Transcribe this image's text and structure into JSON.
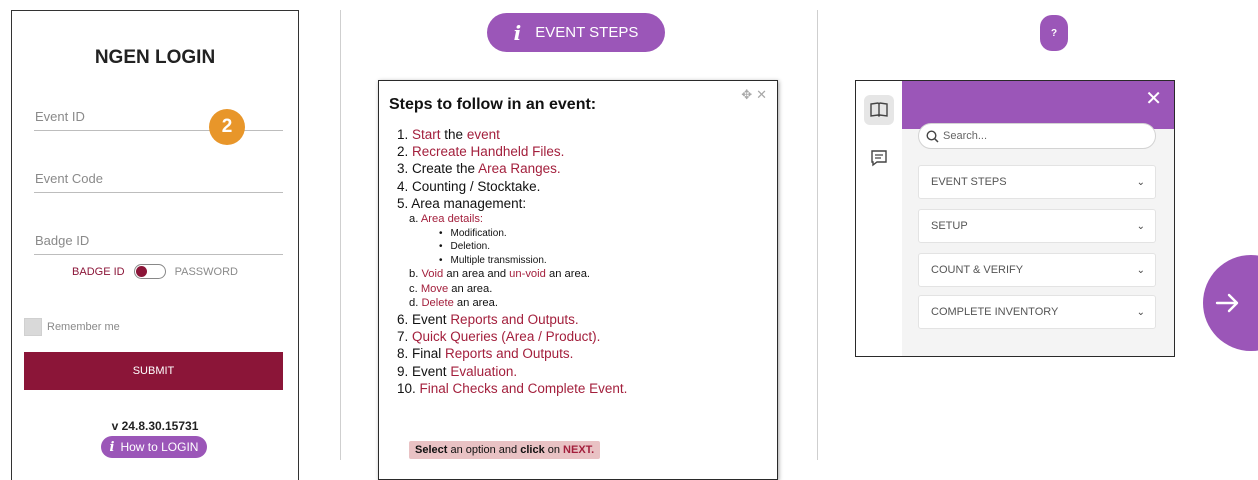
{
  "login": {
    "title": "NGEN LOGIN",
    "event_id_placeholder": "Event ID",
    "event_code_placeholder": "Event Code",
    "badge_id_placeholder": "Badge ID",
    "step_badge": "2",
    "toggle_left": "BADGE ID",
    "toggle_right": "PASSWORD",
    "remember": "Remember me",
    "submit": "SUBMIT",
    "version": "v 24.8.30.15731",
    "howto": "How to LOGIN"
  },
  "event_steps_button": {
    "label": "EVENT STEPS",
    "icon": "info-icon"
  },
  "steps_panel": {
    "title": "Steps to follow in an event:",
    "items": {
      "s1": {
        "num": "1.",
        "a": "Start",
        "b": " the ",
        "c": "event"
      },
      "s2": {
        "num": "2.",
        "a": "Recreate Handheld Files."
      },
      "s3": {
        "num": "3.",
        "a": "Create the ",
        "b": "Area Ranges."
      },
      "s4": {
        "num": "4.",
        "a": "Counting / Stocktake."
      },
      "s5": {
        "num": "5.",
        "a": "Area management:"
      },
      "s5a": {
        "num": "a.",
        "a": "Area details:"
      },
      "s5a1": "Modification.",
      "s5a2": "Deletion.",
      "s5a3": "Multiple transmission.",
      "s5b": {
        "num": "b.",
        "a": "Void",
        "b": " an area and ",
        "c": "un-void",
        "d": " an area."
      },
      "s5c": {
        "num": "c.",
        "a": "Move",
        "b": " an area."
      },
      "s5d": {
        "num": "d.",
        "a": "Delete",
        "b": " an area."
      },
      "s6": {
        "num": "6.",
        "a": "Event ",
        "b": "Reports and Outputs."
      },
      "s7": {
        "num": "7.",
        "a": "Quick Queries (Area / Product)."
      },
      "s8": {
        "num": "8.",
        "a": "Final ",
        "b": "Reports and Outputs."
      },
      "s9": {
        "num": "9.",
        "a": "Event ",
        "b": "Evaluation."
      },
      "s10": {
        "num": "10.",
        "a": "Final Checks and Complete Event."
      }
    },
    "footer": {
      "select": "Select",
      "mid": " an option and ",
      "click": "click",
      "on": " on ",
      "next": "NEXT."
    }
  },
  "help_widget": {
    "badge": "?",
    "search_placeholder": "Search...",
    "sections": [
      "EVENT STEPS",
      "SETUP",
      "COUNT & VERIFY",
      "COMPLETE INVENTORY"
    ]
  },
  "colors": {
    "accent": "#9b56b8",
    "brand": "#8b1538",
    "step_badge": "#e8962a",
    "link_red": "#a31f3c"
  }
}
